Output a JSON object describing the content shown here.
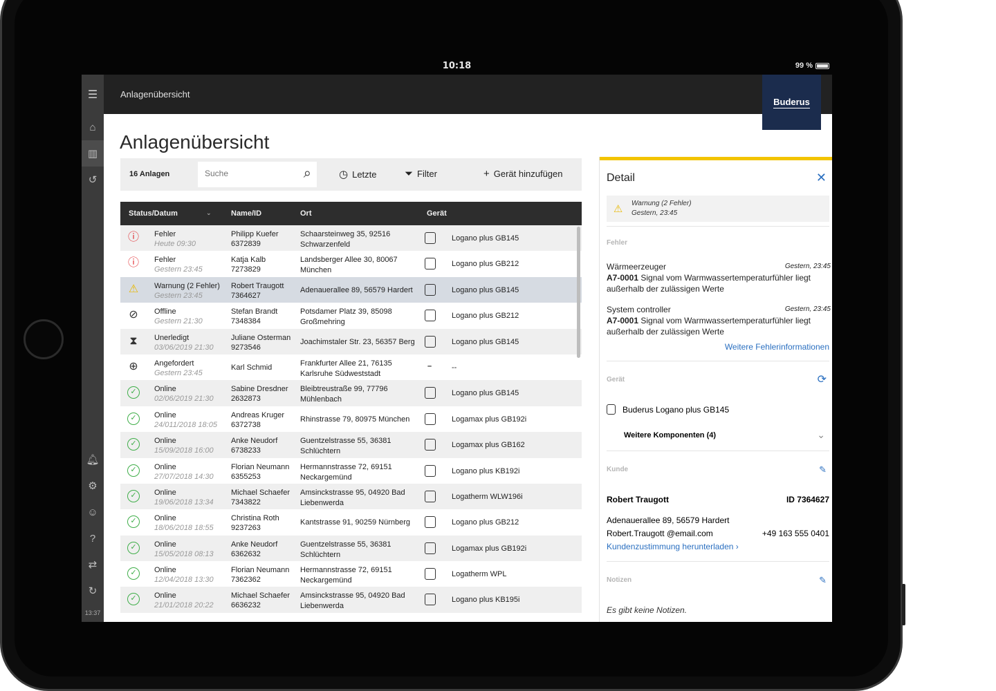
{
  "status_bar": {
    "time": "10:18",
    "battery": "99 %"
  },
  "app": {
    "breadcrumb": "Anlagenübersicht",
    "brand": "Buderus",
    "page_title": "Anlagenübersicht"
  },
  "rail": {
    "time": "13:37"
  },
  "toolbar": {
    "count": "16 Anlagen",
    "search_placeholder": "Suche",
    "recent_label": "Letzte",
    "filter_label": "Filter",
    "add_label": "Gerät hinzufügen"
  },
  "table": {
    "columns": [
      "Status/Datum",
      "Name/ID",
      "Ort",
      "Gerät"
    ],
    "rows": [
      {
        "status": "Fehler",
        "date": "Heute 09:30",
        "name": "Philipp Kuefer",
        "id": "6372839",
        "ort1": "Schaarsteinweg 35, 92516",
        "ort2": "Schwarzenfeld",
        "device": "Logano plus GB145",
        "icon": "error"
      },
      {
        "status": "Fehler",
        "date": "Gestern 23:45",
        "name": "Katja Kalb",
        "id": "7273829",
        "ort1": "Landsberger Allee 30, 80067",
        "ort2": "München",
        "device": "Logano plus GB212",
        "icon": "error"
      },
      {
        "status": "Warnung (2 Fehler)",
        "date": "Gestern 23:45",
        "name": "Robert Traugott",
        "id": "7364627",
        "ort1": "Adenauerallee 89, 56579 Hardert",
        "ort2": "",
        "device": "Logano plus GB145",
        "icon": "warning"
      },
      {
        "status": "Offline",
        "date": "Gestern 21:30",
        "name": "Stefan Brandt",
        "id": "7348384",
        "ort1": "Potsdamer Platz 39, 85098",
        "ort2": "Großmehring",
        "device": "Logano plus GB212",
        "icon": "offline"
      },
      {
        "status": "Unerledigt",
        "date": "03/06/2019 21:30",
        "name": "Juliane Osterman",
        "id": "9273546",
        "ort1": "Joachimstaler Str. 23, 56357 Berg",
        "ort2": "",
        "device": "Logano plus GB145",
        "icon": "pending"
      },
      {
        "status": "Angefordert",
        "date": "Gestern 23:45",
        "name": "Karl Schmid",
        "id": "",
        "ort1": "Frankfurter Allee 21, 76135",
        "ort2": "Karlsruhe Südweststadt",
        "device": "--",
        "icon": "requested"
      },
      {
        "status": "Online",
        "date": "02/06/2019 21:30",
        "name": "Sabine Dresdner",
        "id": "2632873",
        "ort1": "Bleibtreustraße 99, 77796",
        "ort2": "Mühlenbach",
        "device": "Logano plus GB145",
        "icon": "online"
      },
      {
        "status": "Online",
        "date": "24/011/2018 18:05",
        "name": "Andreas Kruger",
        "id": "6372738",
        "ort1": "Rhinstrasse 79, 80975 München",
        "ort2": "",
        "device": "Logamax plus GB192i",
        "icon": "online"
      },
      {
        "status": "Online",
        "date": "15/09/2018 16:00",
        "name": "Anke Neudorf",
        "id": "6738233",
        "ort1": "Guentzelstrasse 55, 36381",
        "ort2": "Schlüchtern",
        "device": "Logamax plus GB162",
        "icon": "online"
      },
      {
        "status": "Online",
        "date": "27/07/2018 14:30",
        "name": "Florian Neumann",
        "id": "6355253",
        "ort1": "Hermannstrasse 72, 69151",
        "ort2": "Neckargemünd",
        "device": "Logano plus KB192i",
        "icon": "online"
      },
      {
        "status": "Online",
        "date": "19/06/2018 13:34",
        "name": "Michael Schaefer",
        "id": "7343822",
        "ort1": "Amsinckstrasse 95, 04920 Bad",
        "ort2": "Liebenwerda",
        "device": "Logatherm WLW196i",
        "icon": "online"
      },
      {
        "status": "Online",
        "date": "18/06/2018 18:55",
        "name": "Christina Roth",
        "id": "9237263",
        "ort1": "Kantstrasse 91, 90259 Nürnberg",
        "ort2": "",
        "device": "Logano plus GB212",
        "icon": "online"
      },
      {
        "status": "Online",
        "date": "15/05/2018 08:13",
        "name": "Anke Neudorf",
        "id": "6362632",
        "ort1": "Guentzelstrasse 55, 36381",
        "ort2": "Schlüchtern",
        "device": "Logamax plus GB192i",
        "icon": "online"
      },
      {
        "status": "Online",
        "date": "12/04/2018 13:30",
        "name": "Florian Neumann",
        "id": "7362362",
        "ort1": "Hermannstrasse 72, 69151",
        "ort2": "Neckargemünd",
        "device": "Logatherm WPL",
        "icon": "online"
      },
      {
        "status": "Online",
        "date": "21/01/2018 20:22",
        "name": "Michael Schaefer",
        "id": "6636232",
        "ort1": "Amsinckstrasse 95, 04920 Bad",
        "ort2": "Liebenwerda",
        "device": "Logano plus KB195i",
        "icon": "online"
      }
    ]
  },
  "detail": {
    "title": "Detail",
    "warning_title": "Warnung (2 Fehler)",
    "warning_time": "Gestern, 23:45",
    "errors_label": "Fehler",
    "errors": [
      {
        "source": "Wärmeerzeuger",
        "time": "Gestern, 23:45",
        "code": "A7-0001",
        "text": "Signal vom Warmwassertemperaturfühler liegt außerhalb der zulässigen Werte"
      },
      {
        "source": "System controller",
        "time": "Gestern, 23:45",
        "code": "A7-0001",
        "text": "Signal vom Warmwassertemperaturfühler liegt außerhalb der zulässigen Werte"
      }
    ],
    "more_errors_link": "Weitere Fehlerinformationen",
    "device_label": "Gerät",
    "device_name": "Buderus Logano plus GB145",
    "components": "Weitere Komponenten (4)",
    "customer_label": "Kunde",
    "customer_name": "Robert Traugott",
    "customer_id": "ID 7364627",
    "customer_address": "Adenauerallee 89, 56579 Hardert",
    "customer_email": "Robert.Traugott @email.com",
    "customer_phone": "+49 163 555 0401",
    "consent_link": "Kundenzustimmung herunterladen",
    "notes_label": "Notizen",
    "notes_empty": "Es gibt keine Notizen."
  },
  "colors": {
    "accent_yellow": "#f3c400",
    "brand_navy": "#1b2c4d",
    "link_blue": "#2a6fc0",
    "error_red": "#e0262b",
    "online_green": "#3fae49"
  }
}
